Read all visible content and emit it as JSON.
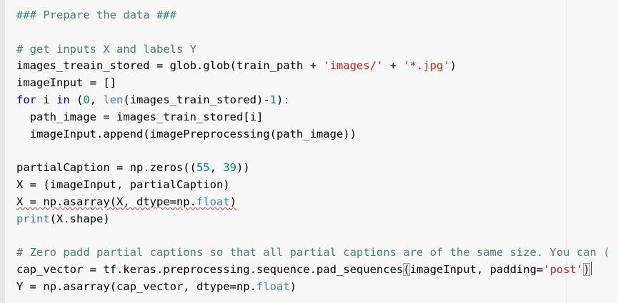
{
  "lines": [
    [
      {
        "t": "### Prepare the data ###",
        "c": "c"
      }
    ],
    [],
    [
      {
        "t": "# get inputs X and labels Y",
        "c": "c"
      }
    ],
    [
      {
        "t": "images_treain_stored = glob.glob(train_path + "
      },
      {
        "t": "'images/'",
        "c": "s"
      },
      {
        "t": " + "
      },
      {
        "t": "'*.jpg'",
        "c": "s"
      },
      {
        "t": ")"
      }
    ],
    [
      {
        "t": "imageInput = []"
      }
    ],
    [
      {
        "t": "for",
        "c": "k"
      },
      {
        "t": " i "
      },
      {
        "t": "in",
        "c": "k"
      },
      {
        "t": " ("
      },
      {
        "t": "0",
        "c": "n"
      },
      {
        "t": ", "
      },
      {
        "t": "len",
        "c": "b"
      },
      {
        "t": "(images_train_stored)-"
      },
      {
        "t": "1",
        "c": "n"
      },
      {
        "t": "):"
      }
    ],
    [
      {
        "t": "  path_image = images_train_stored[i]"
      }
    ],
    [
      {
        "t": "  imageInput.append(imagePreprocessing(path_image))"
      }
    ],
    [],
    [
      {
        "t": "partialCaption = np.zeros(("
      },
      {
        "t": "55",
        "c": "n"
      },
      {
        "t": ", "
      },
      {
        "t": "39",
        "c": "n"
      },
      {
        "t": "))"
      }
    ],
    [
      {
        "t": "X = (imageInput, partialCaption)"
      }
    ],
    [
      {
        "t": "X = np.asarray(X, dtype=np.",
        "u": true
      },
      {
        "t": "float",
        "c": "b",
        "u": true
      },
      {
        "t": ")",
        "u": true
      }
    ],
    [
      {
        "t": "print",
        "c": "b"
      },
      {
        "t": "(X.shape)"
      }
    ],
    [],
    [
      {
        "t": "# Zero padd partial captions so that all partial captions are of the same size. You can (",
        "c": "c"
      }
    ],
    [
      {
        "t": "cap_vector = tf.keras.preprocessing.sequence.pad_sequences"
      },
      {
        "t": "(",
        "x": "bracket"
      },
      {
        "t": "imageInput, padding="
      },
      {
        "t": "'post'",
        "c": "s"
      },
      {
        "t": ")",
        "x": "bracket"
      },
      {
        "caret": true
      }
    ],
    [
      {
        "t": "Y = np.asarray(cap_vector, dtype=np."
      },
      {
        "t": "float",
        "c": "b"
      },
      {
        "t": ")"
      }
    ]
  ]
}
